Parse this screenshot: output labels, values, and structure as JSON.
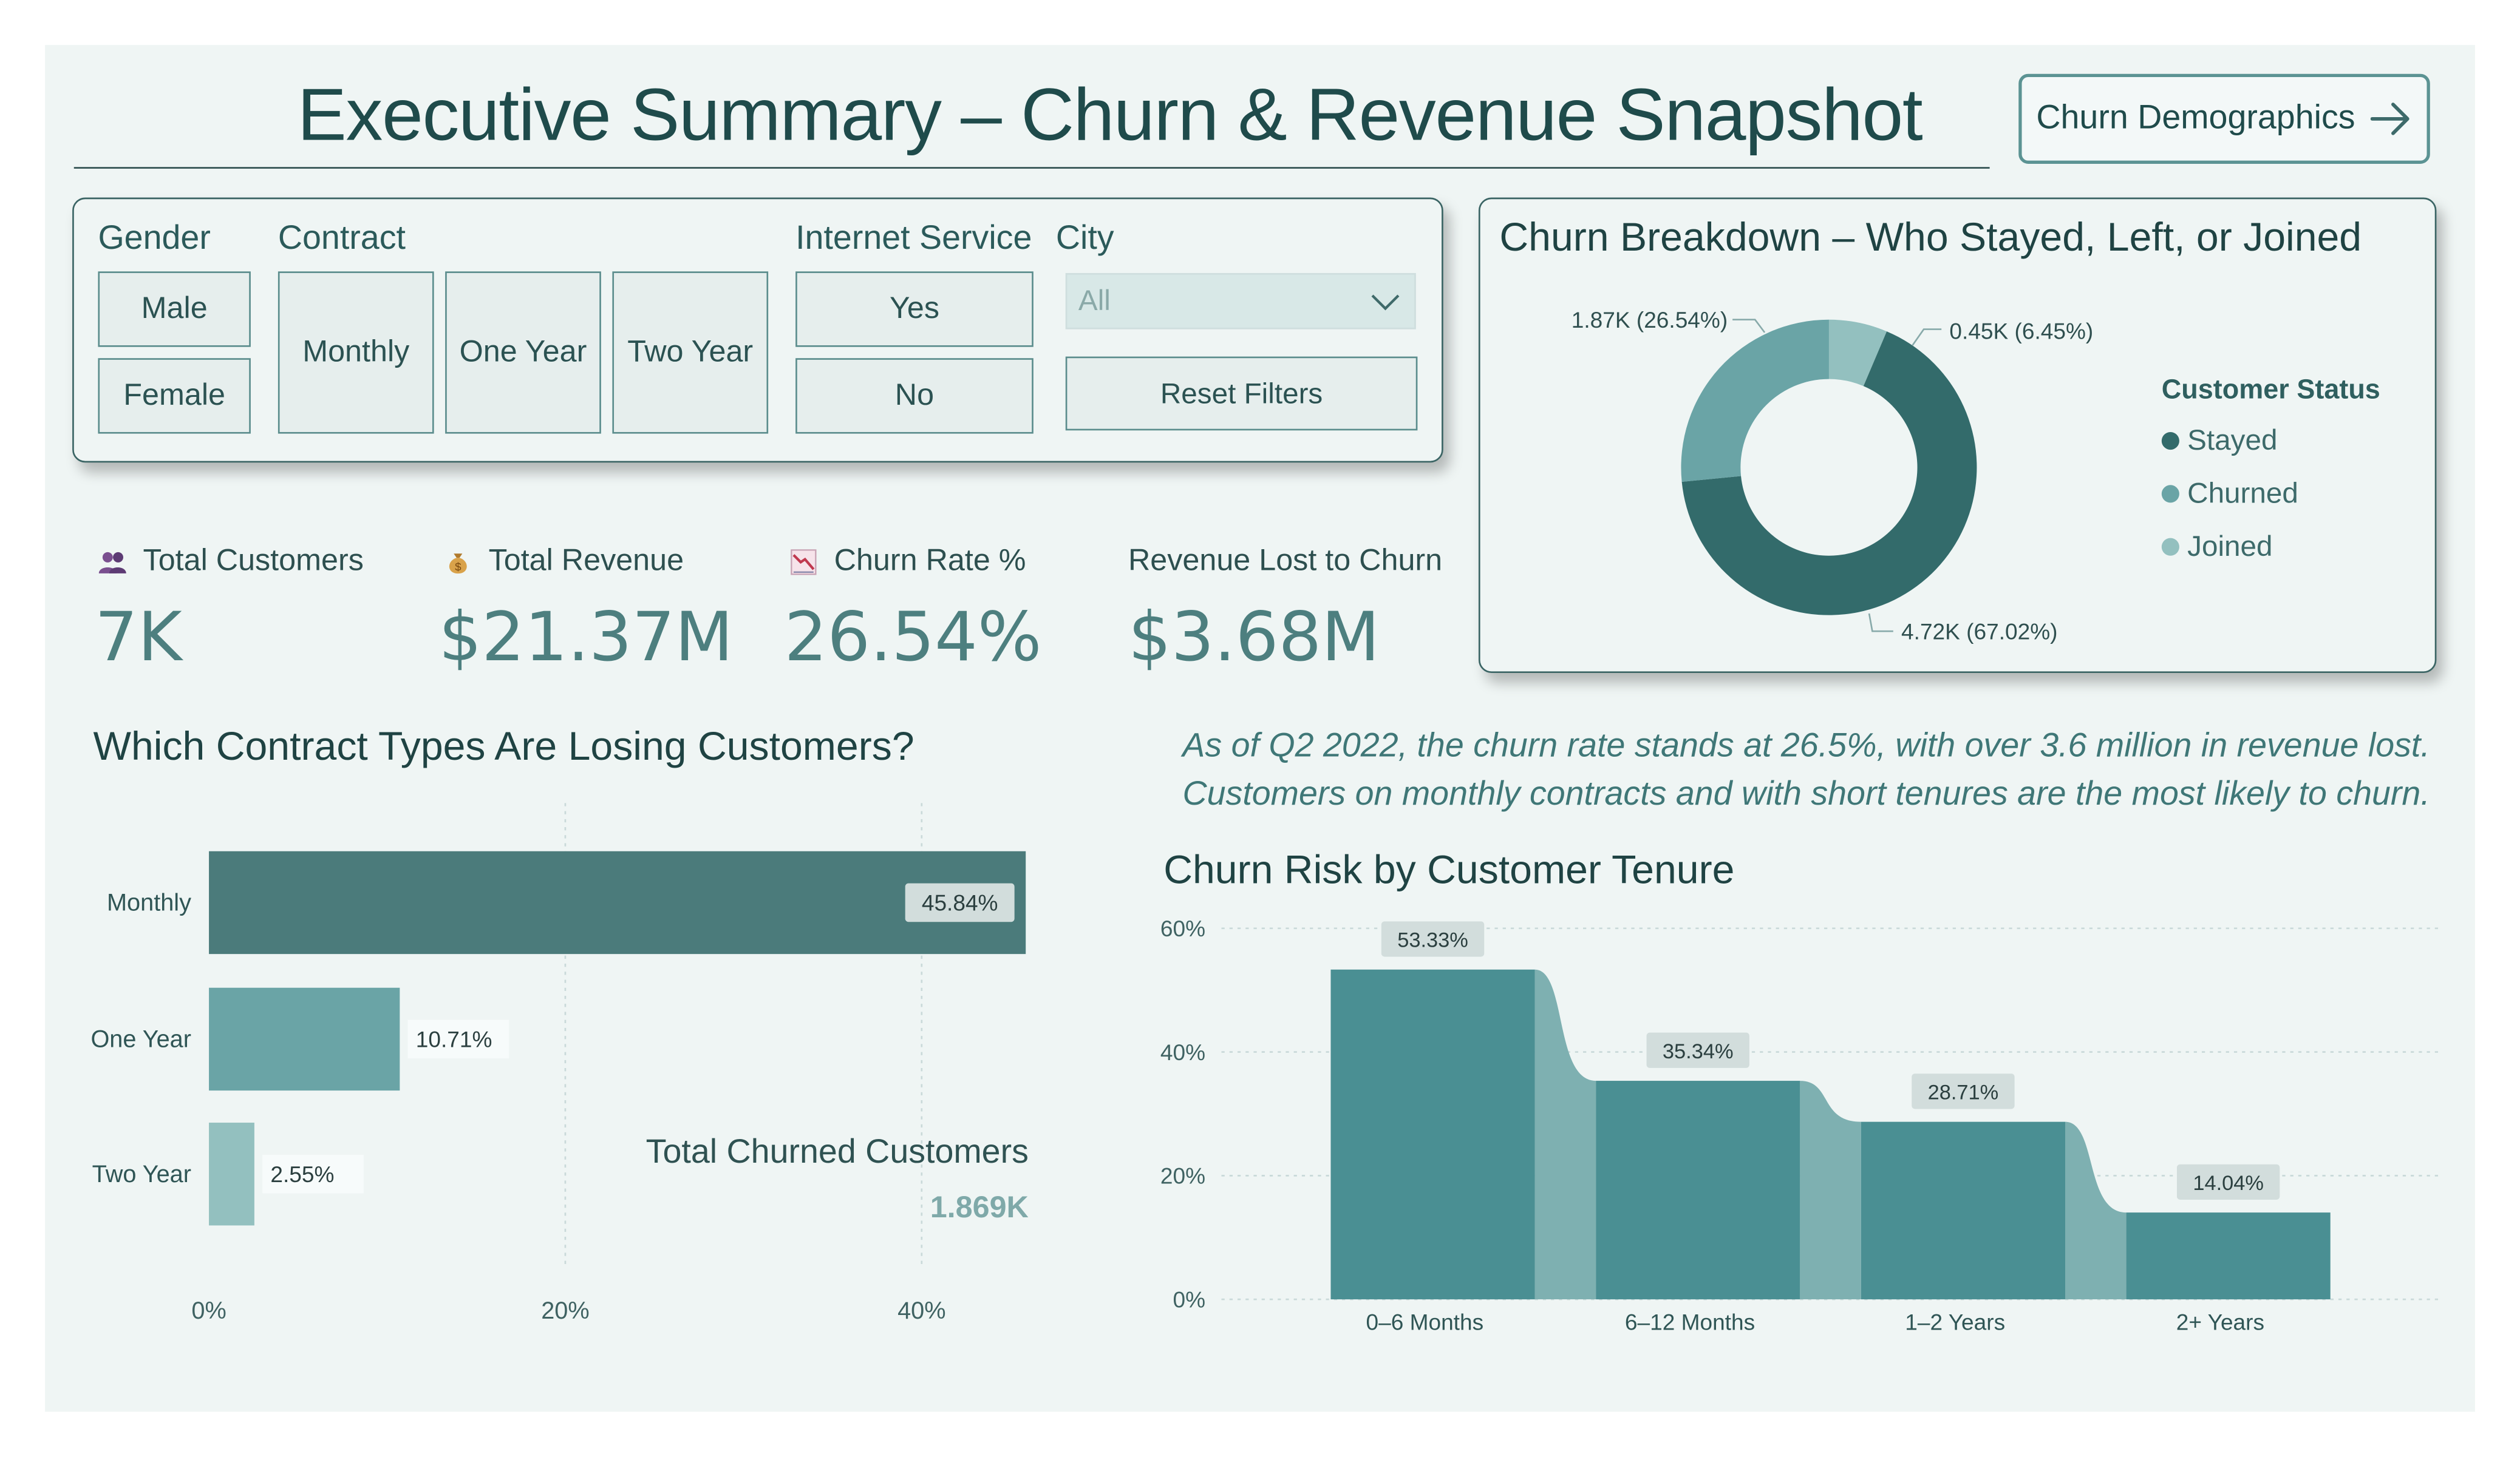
{
  "header": {
    "title": "Executive Summary – Churn & Revenue Snapshot",
    "nav_button": "Churn Demographics",
    "nav_icon": "arrow-right-icon"
  },
  "filters": {
    "gender": {
      "label": "Gender",
      "options": [
        "Male",
        "Female"
      ]
    },
    "contract": {
      "label": "Contract",
      "options": [
        "Monthly",
        "One Year",
        "Two Year"
      ]
    },
    "internet_service": {
      "label": "Internet Service",
      "options": [
        "Yes",
        "No"
      ]
    },
    "city": {
      "label": "City",
      "selected": "All"
    },
    "reset_label": "Reset Filters"
  },
  "kpis": [
    {
      "label": "Total Customers",
      "value": "7K",
      "icon": "people-icon"
    },
    {
      "label": "Total Revenue",
      "value": "$21.37M",
      "icon": "money-bag-icon"
    },
    {
      "label": "Churn Rate %",
      "value": "26.54%",
      "icon": "chart-down-icon"
    },
    {
      "label": "Revenue Lost to Churn",
      "value": "$3.68M"
    }
  ],
  "note": {
    "line1": "As of Q2 2022, the churn rate stands at 26.5%, with over 3.6 million in revenue lost.",
    "line2": "Customers on monthly contracts and with short tenures are the most likely to churn."
  },
  "total_churned": {
    "label": "Total Churned Customers",
    "value": "1.869K"
  },
  "colors": {
    "dark_teal": "#336b6b",
    "teal": "#6aa4a6",
    "light_teal": "#93c0bf",
    "tenure_bar": "#4a8f93",
    "tenure_connector": "#7eb0b1",
    "accent_text": "#4d7f7f"
  },
  "chart_data": [
    {
      "type": "pie",
      "title": "Churn Breakdown – Who Stayed, Left, or Joined",
      "legend_title": "Customer Status",
      "legend_position": "right",
      "series": [
        {
          "name": "Stayed",
          "value": 4.72,
          "percent": 67.02,
          "label": "4.72K (67.02%)",
          "color": "#336b6b"
        },
        {
          "name": "Churned",
          "value": 1.87,
          "percent": 26.54,
          "label": "1.87K (26.54%)",
          "color": "#6aa4a6"
        },
        {
          "name": "Joined",
          "value": 0.45,
          "percent": 6.45,
          "label": "0.45K (6.45%)",
          "color": "#93c0bf"
        }
      ]
    },
    {
      "type": "bar",
      "orientation": "horizontal",
      "title": "Which Contract Types Are Losing Customers?",
      "categories": [
        "Monthly",
        "One Year",
        "Two Year"
      ],
      "values": [
        45.84,
        10.71,
        2.55
      ],
      "labels": [
        "45.84%",
        "10.71%",
        "2.55%"
      ],
      "colors": [
        "#4b7b7b",
        "#6aa4a6",
        "#93c0bf"
      ],
      "xlim": [
        0,
        46
      ],
      "xticks": [
        "0%",
        "20%",
        "40%"
      ],
      "xtick_values": [
        0,
        20,
        40
      ],
      "grid": true
    },
    {
      "type": "bar",
      "title": "Churn Risk by Customer Tenure",
      "categories": [
        "0–6 Months",
        "6–12 Months",
        "1–2 Years",
        "2+ Years"
      ],
      "values": [
        53.33,
        35.34,
        28.71,
        14.04
      ],
      "labels": [
        "53.33%",
        "35.34%",
        "28.71%",
        "14.04%"
      ],
      "ylim": [
        0,
        60
      ],
      "yticks": [
        "0%",
        "20%",
        "40%",
        "60%"
      ],
      "ytick_values": [
        0,
        20,
        40,
        60
      ],
      "grid": true
    }
  ]
}
